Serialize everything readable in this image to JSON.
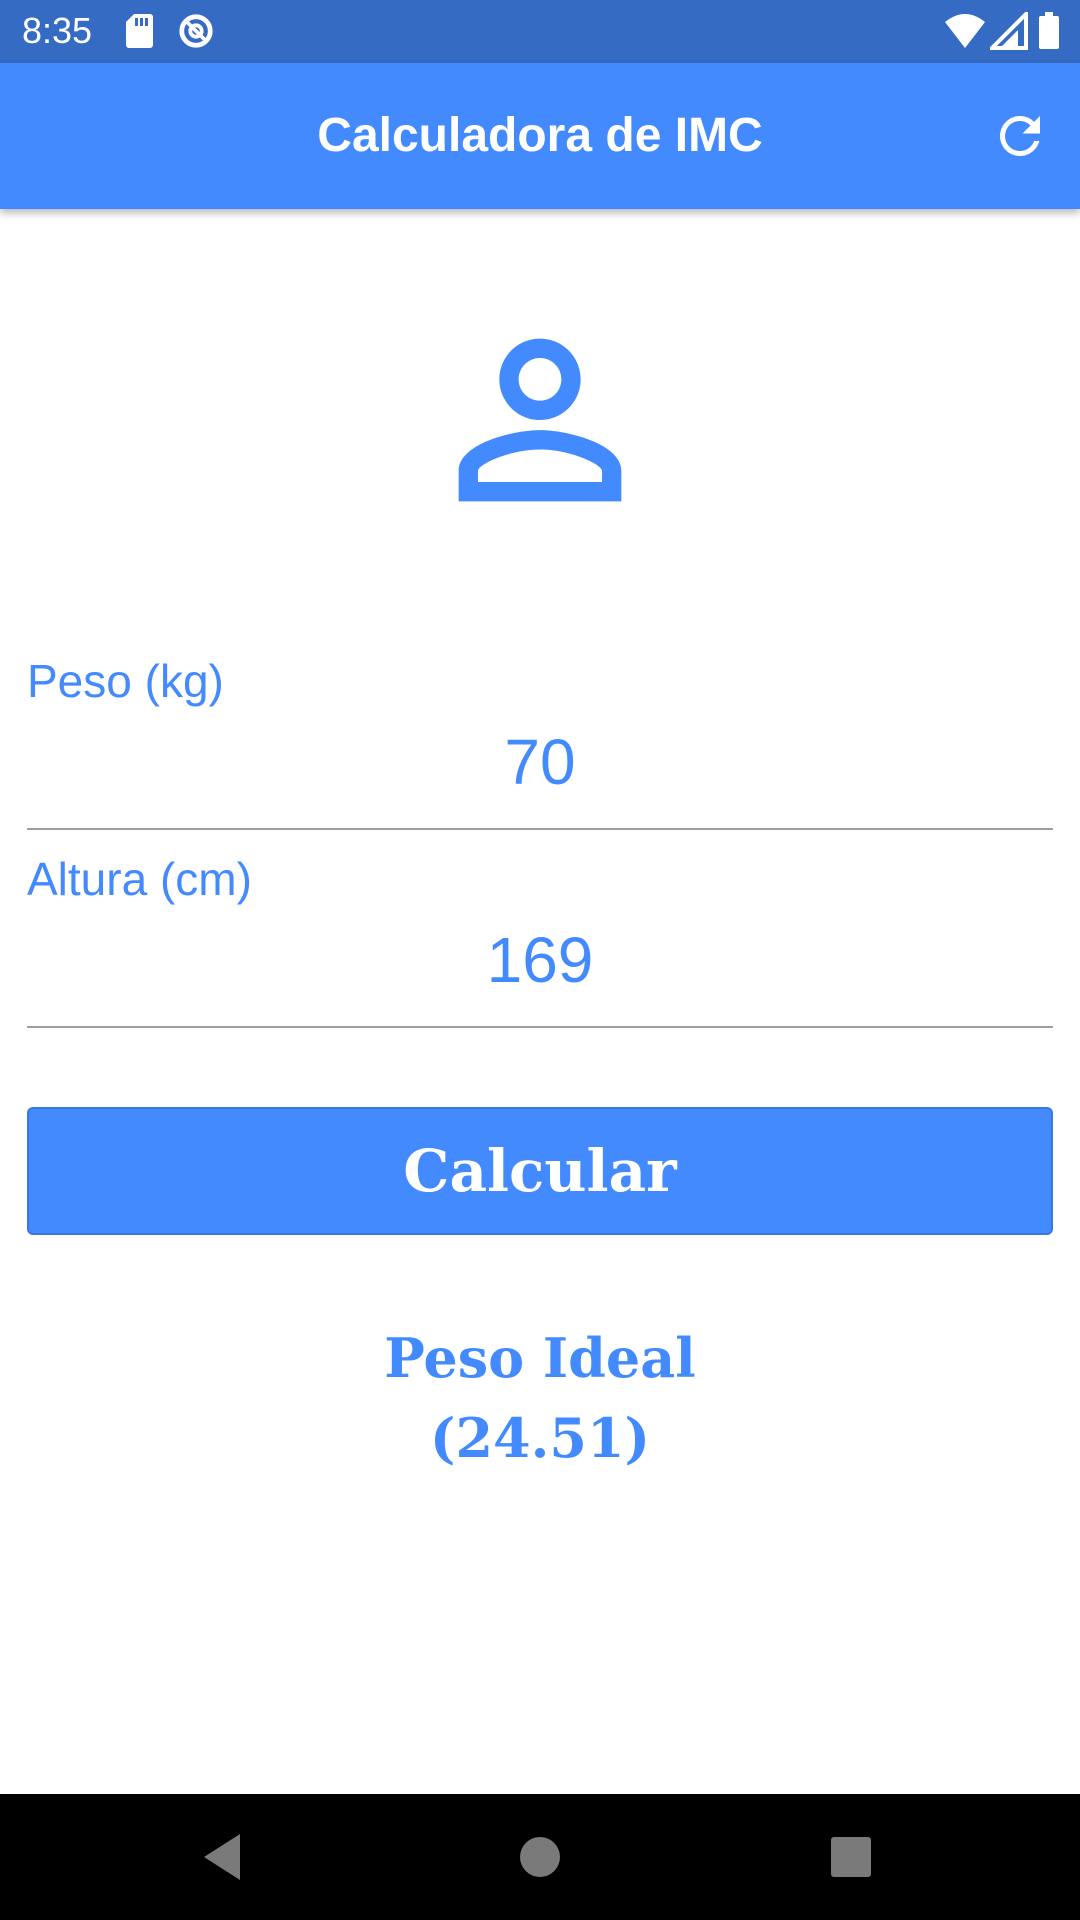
{
  "status_bar": {
    "time": "8:35",
    "background": "#366bc4",
    "icons": [
      "sd-card-icon",
      "do-not-disturb-icon",
      "wifi-icon",
      "cell-signal-icon",
      "battery-icon"
    ]
  },
  "app_bar": {
    "title": "Calculadora de IMC",
    "background": "#448aff",
    "action_icon": "refresh-icon"
  },
  "avatar": {
    "icon": "person-outline-icon",
    "color": "#448aff"
  },
  "form": {
    "weight": {
      "label": "Peso (kg)",
      "value": "70"
    },
    "height": {
      "label": "Altura (cm)",
      "value": "169"
    },
    "accent": "#448aff"
  },
  "button": {
    "label": "Calcular"
  },
  "result": {
    "line1": "Peso Ideal",
    "line2": "(24.51)"
  },
  "nav_bar": {
    "icons": [
      "back-icon",
      "home-icon",
      "recents-icon"
    ]
  }
}
